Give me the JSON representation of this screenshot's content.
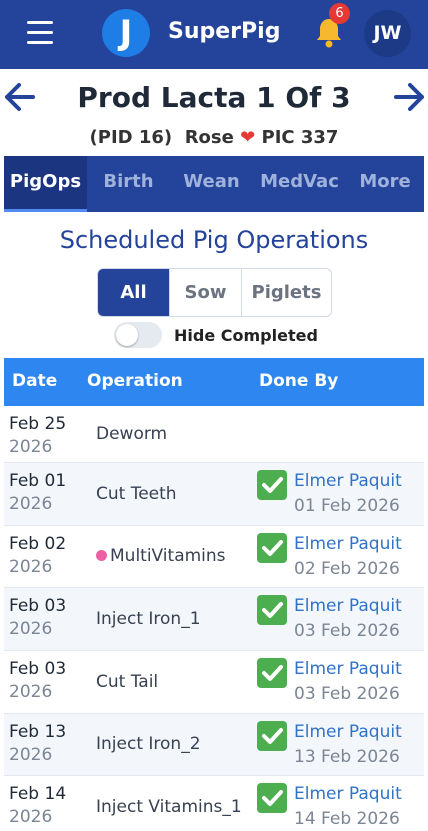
{
  "header": {
    "logo_letter": "J",
    "app_title": "SuperPig",
    "notification_count": "6",
    "avatar_initials": "JW"
  },
  "pig": {
    "title": "Prod Lacta 1 Of 3",
    "pid": "(PID 16)",
    "name": "Rose",
    "pic": "PIC 337"
  },
  "tabs": [
    {
      "label": "PigOps",
      "active": true
    },
    {
      "label": "Birth",
      "active": false
    },
    {
      "label": "Wean",
      "active": false
    },
    {
      "label": "MedVac",
      "active": false
    },
    {
      "label": "More",
      "active": false
    }
  ],
  "section_title": "Scheduled Pig Operations",
  "filter": {
    "options": [
      "All",
      "Sow",
      "Piglets"
    ],
    "selected": "All"
  },
  "hide_completed": {
    "label": "Hide Completed",
    "on": false
  },
  "table": {
    "columns": [
      "Date",
      "Operation",
      "Done By"
    ],
    "rows": [
      {
        "date": "Feb 25",
        "year": "2026",
        "operation": "Deworm",
        "done": false,
        "by": "",
        "on": ""
      },
      {
        "date": "Feb 01",
        "year": "2026",
        "operation": "Cut Teeth",
        "done": true,
        "by": "Elmer Paquit",
        "on": "01 Feb 2026"
      },
      {
        "date": "Feb 02",
        "year": "2026",
        "operation": "MultiVitamins",
        "dot": true,
        "done": true,
        "by": "Elmer Paquit",
        "on": "02 Feb 2026"
      },
      {
        "date": "Feb 03",
        "year": "2026",
        "operation": "Inject Iron_1",
        "done": true,
        "by": "Elmer Paquit",
        "on": "03 Feb 2026"
      },
      {
        "date": "Feb 03",
        "year": "2026",
        "operation": "Cut Tail",
        "done": true,
        "by": "Elmer Paquit",
        "on": "03 Feb 2026"
      },
      {
        "date": "Feb 13",
        "year": "2026",
        "operation": "Inject Iron_2",
        "done": true,
        "by": "Elmer Paquit",
        "on": "13 Feb 2026"
      },
      {
        "date": "Feb 14",
        "year": "2026",
        "operation": "Inject Vitamins_1",
        "done": true,
        "by": "Elmer Paquit",
        "on": "14 Feb 2026"
      }
    ]
  },
  "colors": {
    "nav_bg": "#24439a",
    "accent_blue": "#2e86f0",
    "check_green": "#4cae4f",
    "heart_red": "#e53935",
    "dot_pink": "#ec5fa3"
  }
}
